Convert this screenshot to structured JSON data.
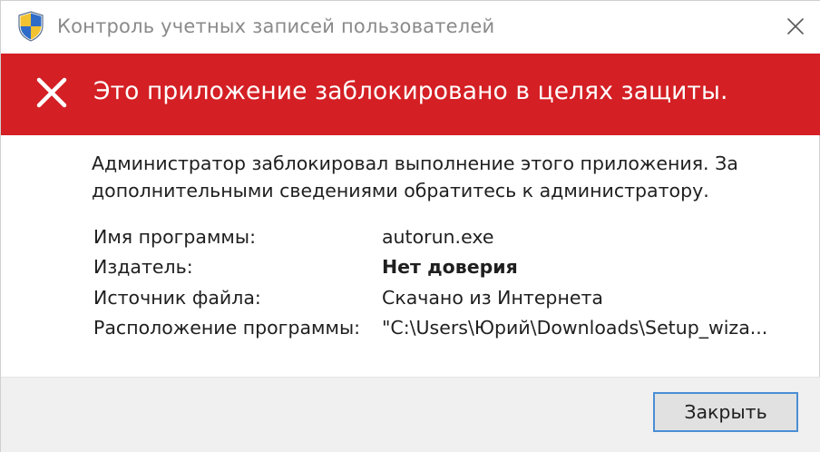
{
  "window": {
    "title": "Контроль учетных записей пользователей"
  },
  "banner": {
    "text": "Это приложение заблокировано в целях защиты.",
    "color": "#d41f24"
  },
  "message": {
    "text": "Администратор заблокировал выполнение этого приложения. За дополнительными сведениями обратитесь к администратору."
  },
  "details": [
    {
      "label": "Имя программы:",
      "value": "autorun.exe"
    },
    {
      "label": "Издатель:",
      "value": "Нет доверия"
    },
    {
      "label": "Источник файла:",
      "value": "Скачано из Интернета"
    },
    {
      "label": "Расположение программы:",
      "value": "\"C:\\Users\\Юрий\\Downloads\\Setup_wiza..."
    }
  ],
  "footer": {
    "close_button_label": "Закрыть",
    "accent": "#4a8fd6"
  },
  "icons": {
    "title": "uac-shield-icon",
    "window_close": "close-icon",
    "banner": "blocked-x-icon"
  }
}
